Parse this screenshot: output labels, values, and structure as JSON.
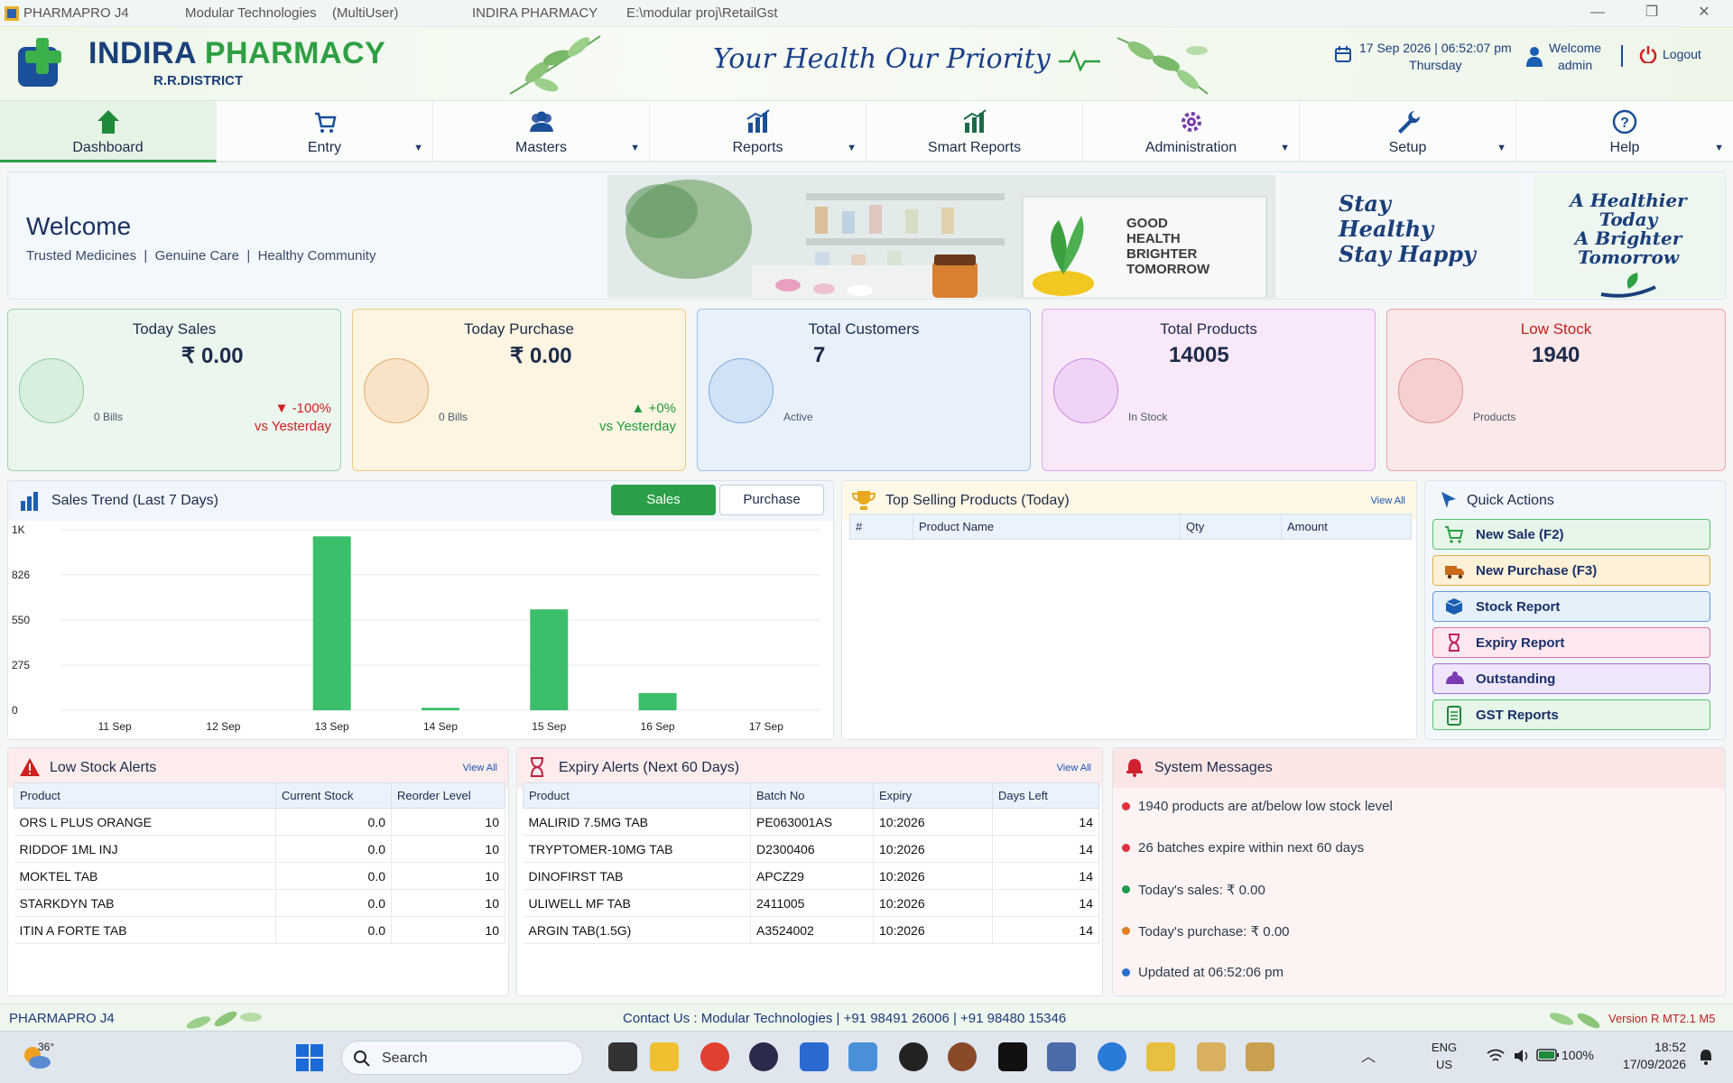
{
  "titlebar": {
    "app": "PHARMAPRO J4",
    "company": "Modular Technologies",
    "mode": "(MultiUser)",
    "shop": "INDIRA PHARMACY",
    "path": "E:\\modular proj\\RetailGst",
    "min": "—",
    "max": "❐",
    "close": "✕"
  },
  "header": {
    "brand_first": "INDIRA",
    "brand_second": "PHARMACY",
    "district": "R.R.DISTRICT",
    "tagline": "Your Health  Our Priority",
    "datetime": "17 Sep 2026 | 06:52:07 pm",
    "day": "Thursday",
    "welcome": "Welcome",
    "user": "admin",
    "logout": "Logout"
  },
  "nav": [
    {
      "label": "Dashboard",
      "icon": "home-icon",
      "caret": ""
    },
    {
      "label": "Entry",
      "icon": "cart-icon",
      "caret": "▼"
    },
    {
      "label": "Masters",
      "icon": "users-icon",
      "caret": "▼"
    },
    {
      "label": "Reports",
      "icon": "bar-chart-icon",
      "caret": "▼"
    },
    {
      "label": "Smart Reports",
      "icon": "bar-chart-icon",
      "caret": ""
    },
    {
      "label": "Administration",
      "icon": "gear-icon",
      "caret": "▼"
    },
    {
      "label": "Setup",
      "icon": "wrench-icon",
      "caret": "▼"
    },
    {
      "label": "Help",
      "icon": "help-icon",
      "caret": "▼"
    }
  ],
  "banner": {
    "title": "Welcome",
    "sub1": "Trusted Medicines",
    "sub2": "Genuine Care",
    "sub3": "Healthy Community",
    "sep": "|",
    "sign1": "GOOD",
    "sign2": "HEALTH",
    "sign3": "BRIGHTER",
    "sign4": "TOMORROW",
    "script1": "Stay",
    "script2": "Healthy",
    "script3": "Stay Happy",
    "side1": "A Healthier",
    "side2": "Today",
    "side3": "A Brighter",
    "side4": "Tomorrow"
  },
  "cards": [
    {
      "title": "Today Sales",
      "value": "₹ 0.00",
      "sub": "0 Bills",
      "delta": "▼ -100%",
      "delta2": "vs Yesterday",
      "color": "#2ea043"
    },
    {
      "title": "Today Purchase",
      "value": "₹ 0.00",
      "sub": "0 Bills",
      "delta": "▲ +0%",
      "delta2": "vs Yesterday",
      "color": "#e0a040"
    },
    {
      "title": "Total Customers",
      "value": "7",
      "sub": "Active",
      "delta": "",
      "delta2": "",
      "color": "#3a7ad0"
    },
    {
      "title": "Total Products",
      "value": "14005",
      "sub": "In Stock",
      "delta": "",
      "delta2": "",
      "color": "#c050d0"
    },
    {
      "title": "Low Stock",
      "value": "1940",
      "sub": "Products",
      "delta": "",
      "delta2": "",
      "color": "#e04050"
    }
  ],
  "trend": {
    "title": "Sales Trend (Last 7 Days)",
    "btn_sales": "Sales",
    "btn_purchase": "Purchase"
  },
  "chart_data": {
    "type": "bar",
    "categories": [
      "11 Sep",
      "12 Sep",
      "13 Sep",
      "14 Sep",
      "15 Sep",
      "16 Sep",
      "17 Sep"
    ],
    "values": [
      0,
      0,
      1060,
      15,
      615,
      105,
      0
    ],
    "ytick_labels": [
      "1K",
      "826",
      "550",
      "275",
      "0"
    ],
    "ytick_values": [
      1100,
      826,
      550,
      275,
      0
    ],
    "ylim": [
      0,
      1100
    ],
    "grid": true,
    "color": "#3cbf6a"
  },
  "topselling": {
    "title": "Top Selling Products (Today)",
    "view_all": "View All",
    "cols": [
      "#",
      "Product Name",
      "Qty",
      "Amount"
    ]
  },
  "quick": {
    "title": "Quick Actions",
    "items": [
      {
        "label": "New Sale (F2)",
        "icon": "cart-icon",
        "bg": "#e6f6e8",
        "border": "#5cc070"
      },
      {
        "label": "New Purchase (F3)",
        "icon": "truck-icon",
        "bg": "#fdf1d8",
        "border": "#e2b04a"
      },
      {
        "label": "Stock Report",
        "icon": "box-icon",
        "bg": "#e6f0fb",
        "border": "#6a9ad8"
      },
      {
        "label": "Expiry Report",
        "icon": "hourglass-icon",
        "bg": "#fde8ef",
        "border": "#e070a0"
      },
      {
        "label": "Outstanding",
        "icon": "money-icon",
        "bg": "#efe6fb",
        "border": "#a070d8"
      },
      {
        "label": "GST Reports",
        "icon": "document-icon",
        "bg": "#e6f6e8",
        "border": "#5cc070"
      }
    ]
  },
  "lowstock": {
    "title": "Low Stock Alerts",
    "view_all": "View All",
    "cols": [
      "Product",
      "Current Stock",
      "Reorder Level"
    ],
    "rows": [
      [
        "ORS L PLUS ORANGE",
        "0.0",
        "10"
      ],
      [
        "RIDDOF 1ML INJ",
        "0.0",
        "10"
      ],
      [
        "MOKTEL TAB",
        "0.0",
        "10"
      ],
      [
        "STARKDYN TAB",
        "0.0",
        "10"
      ],
      [
        "ITIN A FORTE TAB",
        "0.0",
        "10"
      ]
    ]
  },
  "expiry": {
    "title": "Expiry Alerts (Next 60 Days)",
    "view_all": "View All",
    "cols": [
      "Product",
      "Batch No",
      "Expiry",
      "Days Left"
    ],
    "rows": [
      [
        "MALIRID 7.5MG TAB",
        "PE063001AS",
        "10:2026",
        "14"
      ],
      [
        "TRYPTOMER-10MG TAB",
        "D2300406",
        "10:2026",
        "14"
      ],
      [
        "DINOFIRST TAB",
        "APCZ29",
        "10:2026",
        "14"
      ],
      [
        "ULIWELL MF TAB",
        "2411005",
        "10:2026",
        "14"
      ],
      [
        "ARGIN TAB(1.5G)",
        "A3524002",
        "10:2026",
        "14"
      ]
    ]
  },
  "messages": {
    "title": "System Messages",
    "items": [
      {
        "text": "1940 products are at/below low stock level",
        "color": "#e0303a"
      },
      {
        "text": "26 batches expire within next 60 days",
        "color": "#e0303a"
      },
      {
        "text": "Today's sales: ₹ 0.00",
        "color": "#1f9a4a"
      },
      {
        "text": "Today's purchase: ₹ 0.00",
        "color": "#e08020"
      },
      {
        "text": "Updated at 06:52:06 pm",
        "color": "#2a70d0"
      }
    ]
  },
  "footer": {
    "app": "PHARMAPRO J4",
    "contact": "Contact Us :  Modular Technologies   |   +91 98491 26006   |   +91 98480 15346",
    "version": "Version R MT2.1 M5"
  },
  "taskbar": {
    "temp": "36°",
    "search": "Search",
    "lang1": "ENG",
    "lang2": "US",
    "battery": "100%",
    "time": "18:52",
    "date": "17/09/2026"
  }
}
